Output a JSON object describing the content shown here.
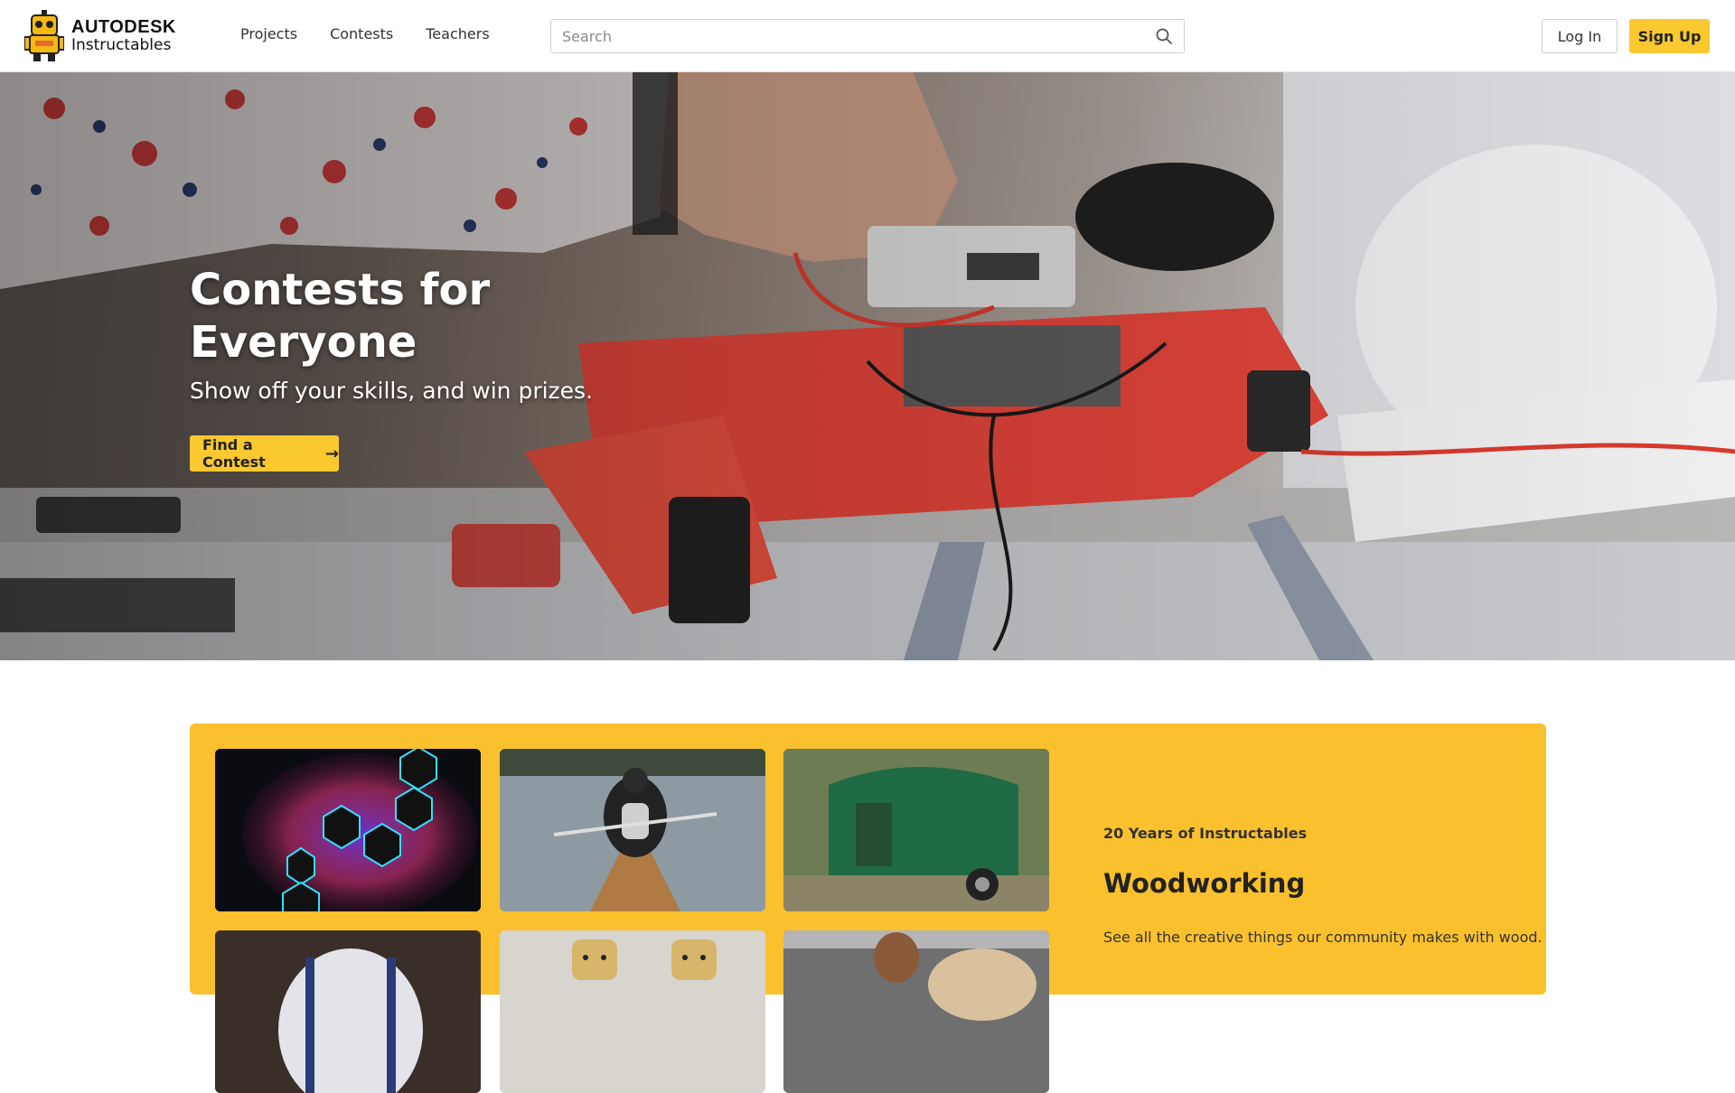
{
  "brand": {
    "line1": "AUTODESK",
    "line2": "Instructables"
  },
  "nav": {
    "projects": "Projects",
    "contests": "Contests",
    "teachers": "Teachers"
  },
  "search": {
    "placeholder": "Search",
    "value": ""
  },
  "auth": {
    "login": "Log In",
    "signup": "Sign Up"
  },
  "hero": {
    "title": "Contests for Everyone",
    "subtitle": "Show off your skills, and win prizes.",
    "cta": "Find a Contest"
  },
  "feature": {
    "kicker": "20 Years of Instructables",
    "title": "Woodworking",
    "description": "See all the creative things our community makes with wood."
  },
  "colors": {
    "accent": "#fac82f",
    "feature_bg": "#fbc02d"
  }
}
